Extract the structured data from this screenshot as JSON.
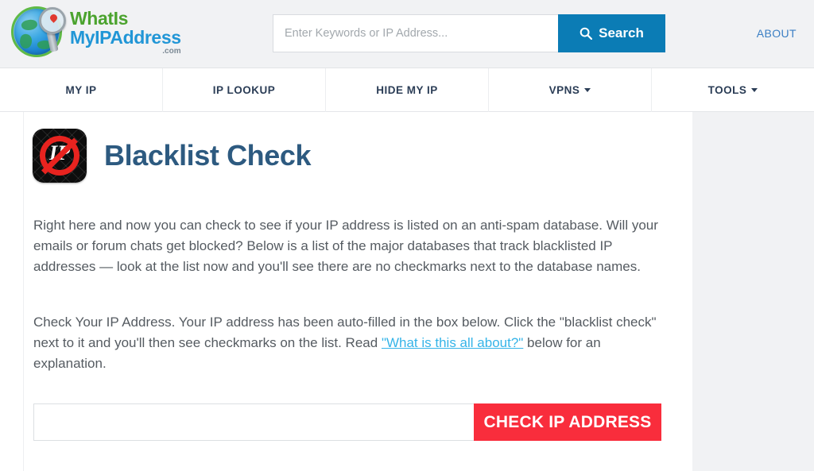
{
  "site": {
    "logo_line1": "WhatIs",
    "logo_line2": "MyIPAddress",
    "logo_dotcom": ".com",
    "logo_icon": "globe-magnifier-icon"
  },
  "search": {
    "placeholder": "Enter Keywords or IP Address...",
    "value": "",
    "button_label": "Search",
    "icon": "search-icon",
    "accent_color": "#0b7cb5"
  },
  "header": {
    "about_label": "ABOUT",
    "about_color": "#3b7fc4",
    "background": "#f1f2f4"
  },
  "nav": {
    "items": [
      {
        "label": "MY IP",
        "has_dropdown": false
      },
      {
        "label": "IP LOOKUP",
        "has_dropdown": false
      },
      {
        "label": "HIDE MY IP",
        "has_dropdown": false
      },
      {
        "label": "VPNS",
        "has_dropdown": true
      },
      {
        "label": "TOOLS",
        "has_dropdown": true
      }
    ],
    "text_color": "#2b3d56"
  },
  "main": {
    "icon": "blocked-ip-icon",
    "title": "Blacklist Check",
    "title_color": "#2d5a80",
    "paragraph1": "Right here and now you can check to see if your IP address is listed on an anti-spam database. Will your emails or forum chats get blocked? Below is a list of the major databases that track blacklisted IP addresses — look at the list now and you'll see there are no checkmarks next to the database names.",
    "paragraph2_part1": "Check Your IP Address. Your IP address has been auto-filled in the box below. Click the \"blacklist check\" next to it and you'll then see checkmarks on the list. Read ",
    "paragraph2_link": "\"What is this all about?\"",
    "paragraph2_part2": " below for an explanation.",
    "link_color": "#35b4e8"
  },
  "checker": {
    "input_value": "",
    "input_placeholder": "",
    "button_label": "CHECK IP ADDRESS",
    "button_color": "#f92d3c"
  },
  "sidebar": {
    "background": "#f1f2f4"
  }
}
